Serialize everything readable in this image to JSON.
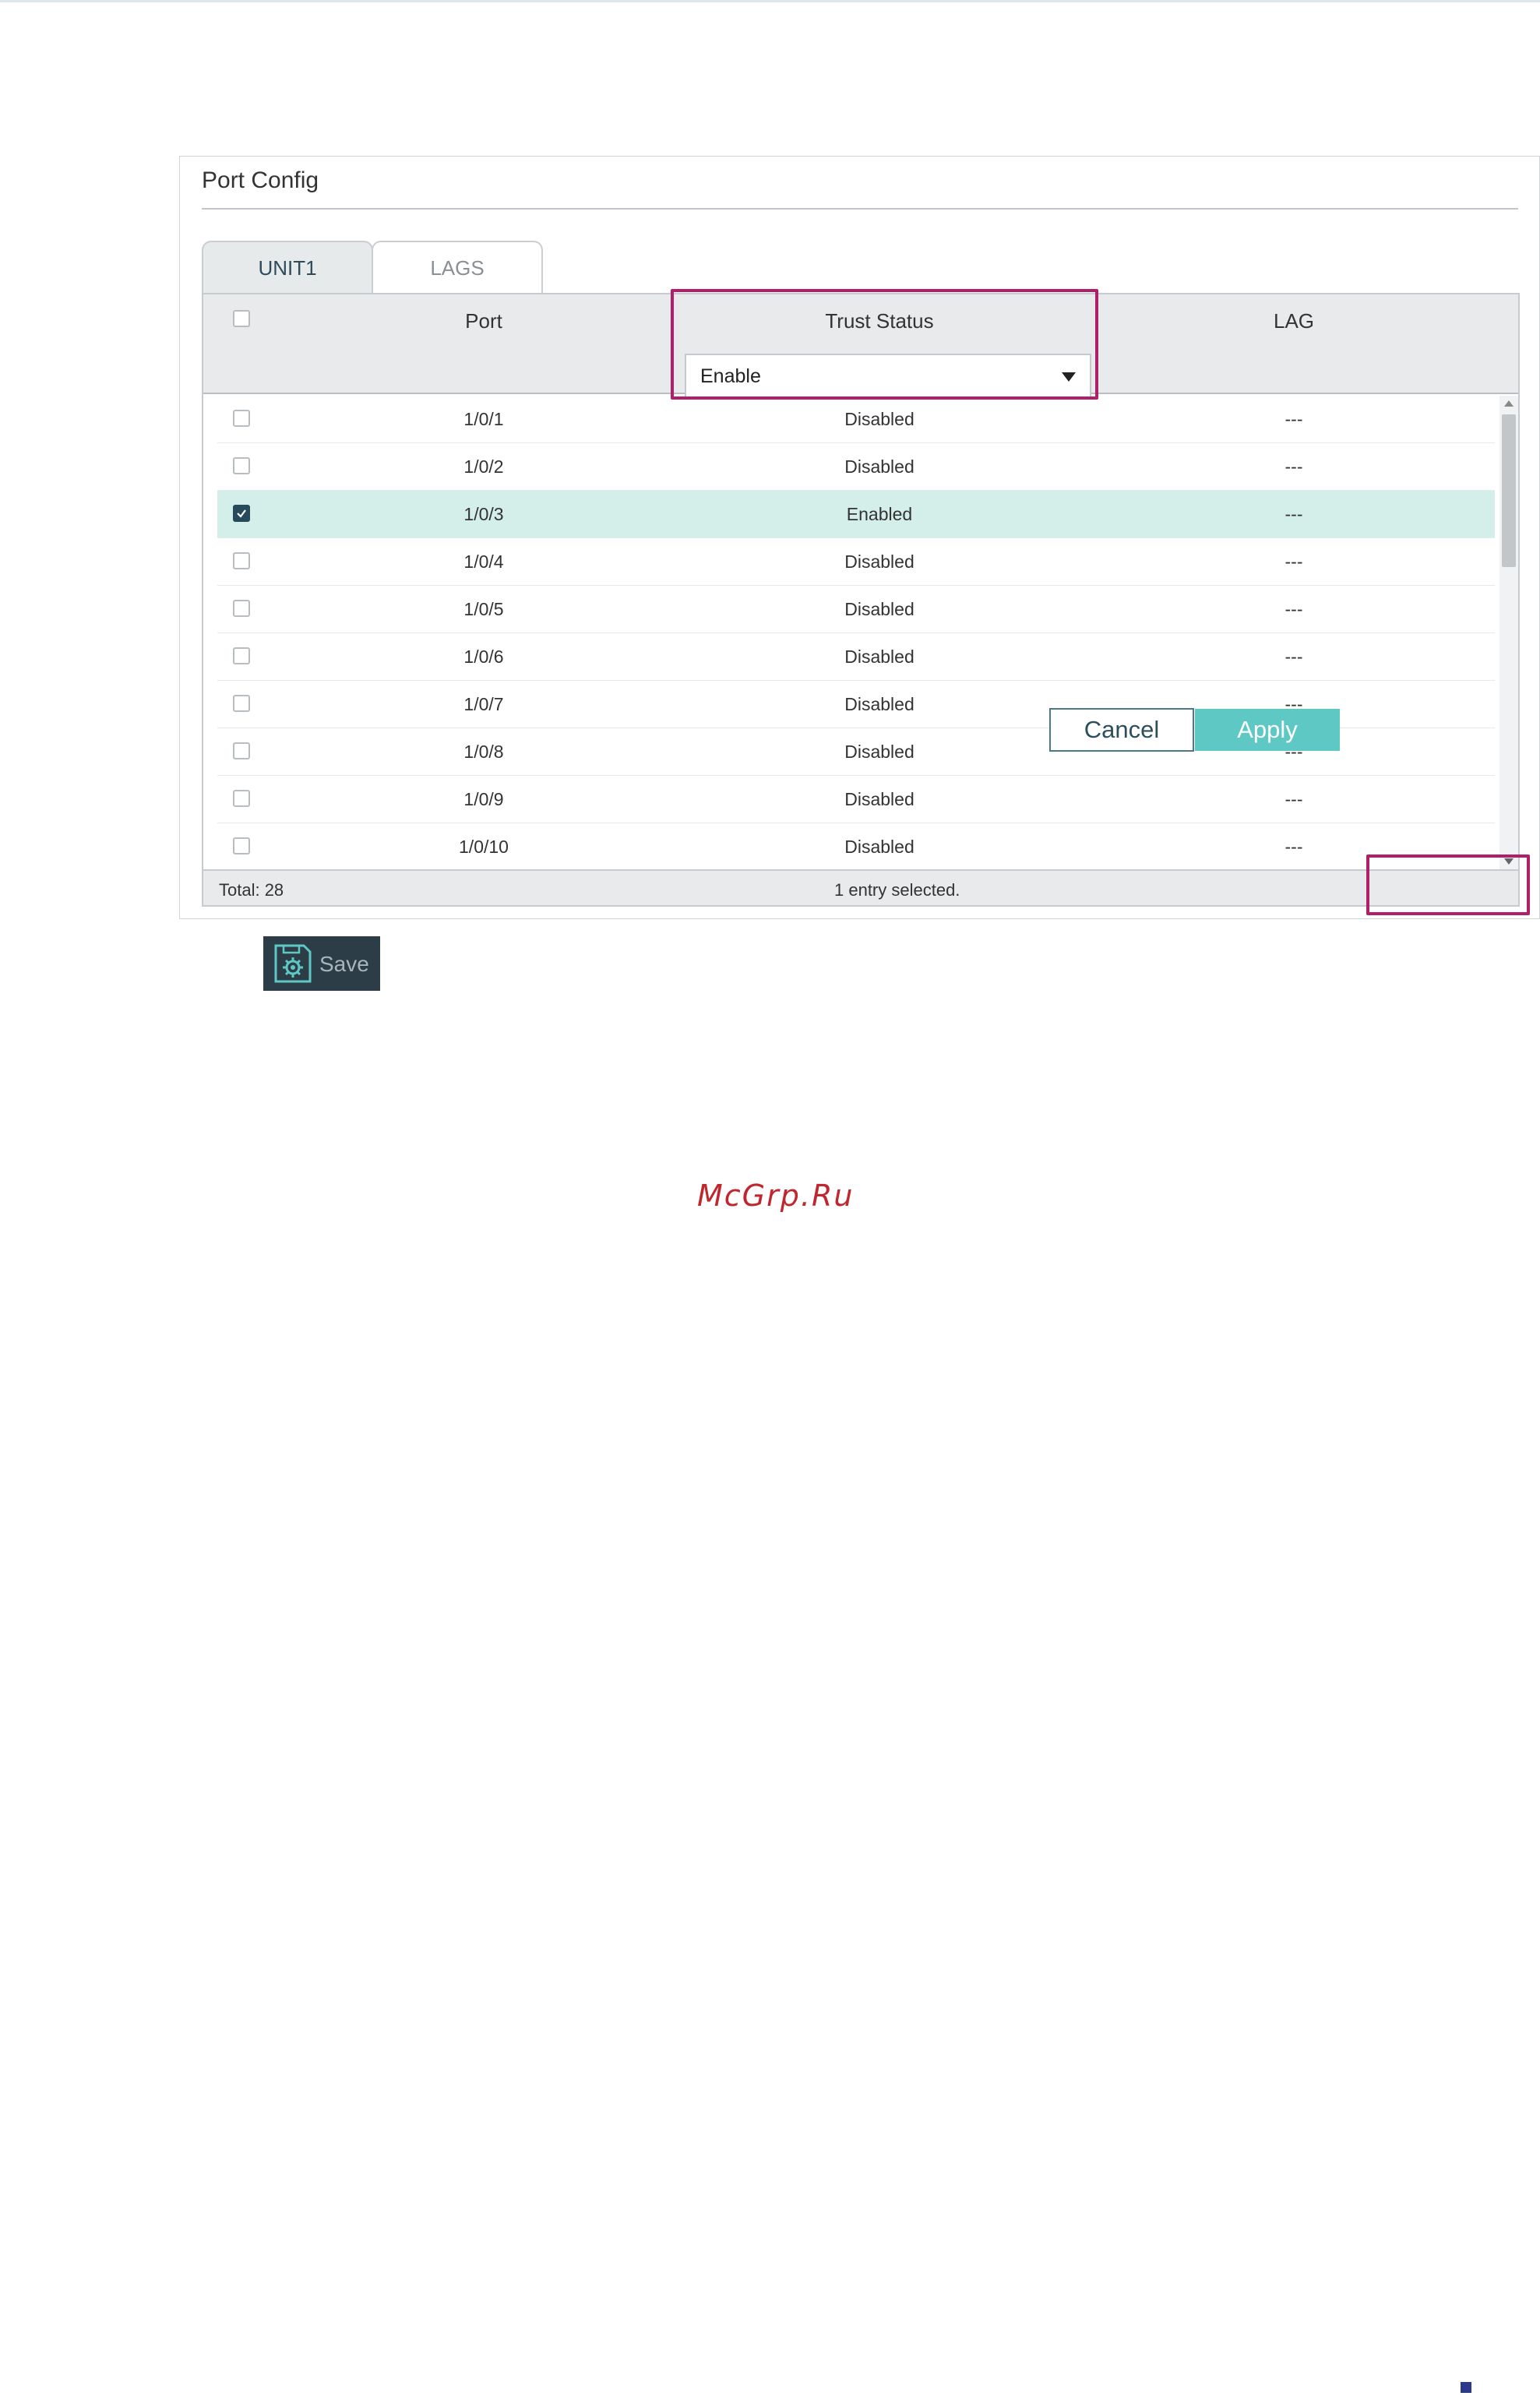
{
  "panel": {
    "title": "Port Config",
    "tabs": [
      "UNIT1",
      "LAGS"
    ],
    "active_tab": "UNIT1"
  },
  "table": {
    "headers": {
      "port": "Port",
      "trust_status": "Trust Status",
      "lag": "LAG"
    },
    "filter": {
      "trust_status_value": "Enable"
    },
    "rows": [
      {
        "port": "1/0/1",
        "trust": "Disabled",
        "lag": "---",
        "checked": false
      },
      {
        "port": "1/0/2",
        "trust": "Disabled",
        "lag": "---",
        "checked": false
      },
      {
        "port": "1/0/3",
        "trust": "Enabled",
        "lag": "---",
        "checked": true
      },
      {
        "port": "1/0/4",
        "trust": "Disabled",
        "lag": "---",
        "checked": false
      },
      {
        "port": "1/0/5",
        "trust": "Disabled",
        "lag": "---",
        "checked": false
      },
      {
        "port": "1/0/6",
        "trust": "Disabled",
        "lag": "---",
        "checked": false
      },
      {
        "port": "1/0/7",
        "trust": "Disabled",
        "lag": "---",
        "checked": false
      },
      {
        "port": "1/0/8",
        "trust": "Disabled",
        "lag": "---",
        "checked": false
      },
      {
        "port": "1/0/9",
        "trust": "Disabled",
        "lag": "---",
        "checked": false
      },
      {
        "port": "1/0/10",
        "trust": "Disabled",
        "lag": "---",
        "checked": false
      }
    ],
    "footer": {
      "total": "Total: 28",
      "selection": "1 entry selected."
    }
  },
  "buttons": {
    "cancel": "Cancel",
    "apply": "Apply",
    "save": "Save"
  },
  "watermark": "McGrp.Ru",
  "colors": {
    "accent": "#5ec9c4",
    "highlight": "#b01f6a",
    "selected_row": "#d4efe9",
    "checkbox_checked": "#264a5c"
  }
}
